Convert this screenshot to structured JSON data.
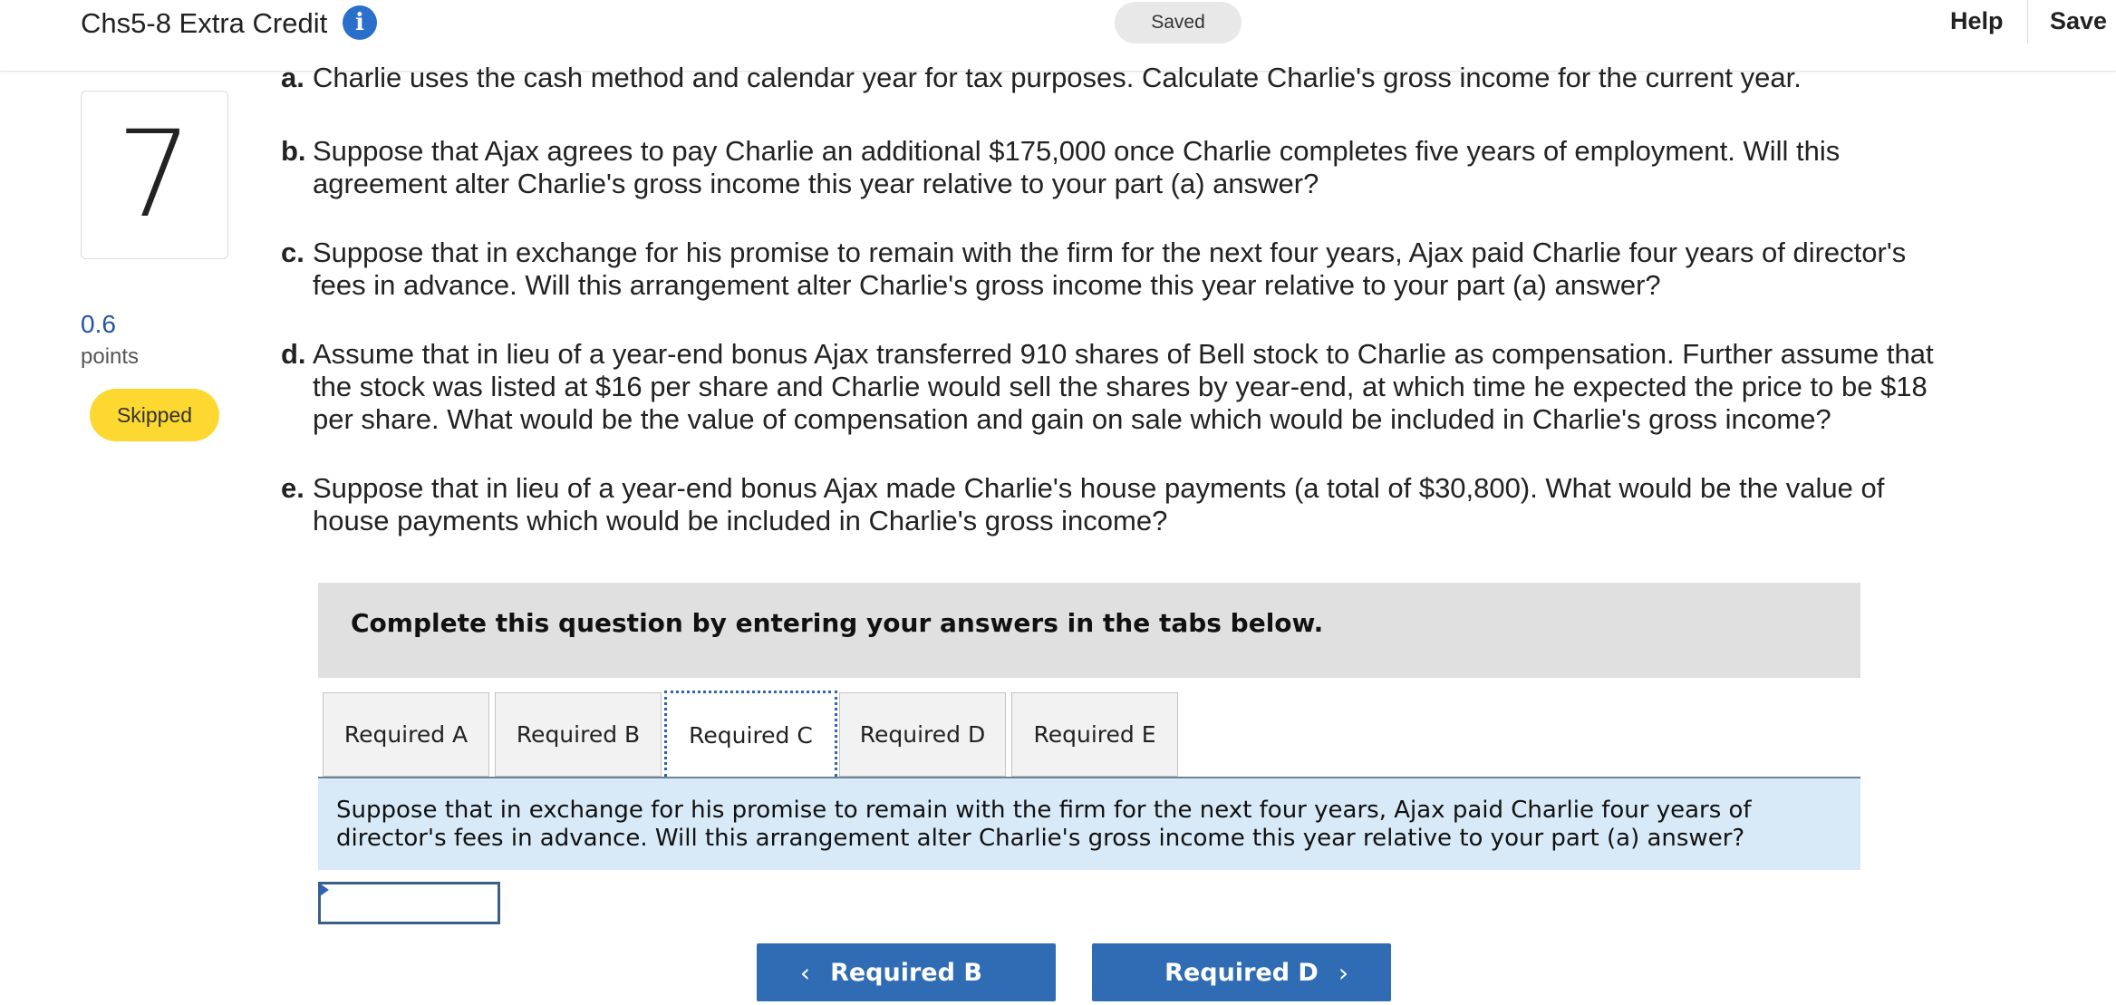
{
  "header": {
    "title": "Chs5-8 Extra Credit",
    "info_icon": "i",
    "saved_label": "Saved",
    "help_label": "Help",
    "save_exit_label": "Save"
  },
  "sidebar": {
    "question_number": "7",
    "points_value": "0.6",
    "points_label": "points",
    "status_badge": "Skipped"
  },
  "questions": [
    {
      "letter": "a.",
      "text": "Charlie uses the cash method and calendar year for tax purposes. Calculate Charlie's gross income for the current year."
    },
    {
      "letter": "b.",
      "text": "Suppose that Ajax agrees to pay Charlie an additional $175,000 once Charlie completes five years of employment. Will this agreement alter Charlie's gross income this year relative to your part (a) answer?"
    },
    {
      "letter": "c.",
      "text": "Suppose that in exchange for his promise to remain with the firm for the next four years, Ajax paid Charlie four years of director's fees in advance. Will this arrangement alter Charlie's gross income this year relative to your part (a) answer?"
    },
    {
      "letter": "d.",
      "text": "Assume that in lieu of a year-end bonus Ajax transferred 910 shares of Bell stock to Charlie as compensation. Further assume that the stock was listed at $16 per share and Charlie would sell the shares by year-end, at which time he expected the price to be $18 per share. What would be the value of compensation and gain on sale which would be included in Charlie's gross income?"
    },
    {
      "letter": "e.",
      "text": "Suppose that in lieu of a year-end bonus Ajax made Charlie's house payments (a total of $30,800). What would be the value of house payments which would be included in Charlie's gross income?"
    }
  ],
  "instruction": "Complete this question by entering your answers in the tabs below.",
  "tabs": [
    {
      "label": "Required A"
    },
    {
      "label": "Required B"
    },
    {
      "label": "Required C"
    },
    {
      "label": "Required D"
    },
    {
      "label": "Required E"
    }
  ],
  "active_tab": "Required C",
  "prompt": "Suppose that in exchange for his promise to remain with the firm for the next four years, Ajax paid Charlie four years of director's fees in advance. Will this arrangement alter Charlie's gross income this year relative to your part (a) answer?",
  "answer_value": "",
  "nav": {
    "prev_label": "Required B",
    "next_label": "Required D",
    "prev_icon": "chevron-left-icon",
    "next_icon": "chevron-right-icon"
  },
  "colors": {
    "accent": "#2f6cb4",
    "badge": "#fcd831",
    "prompt_bg": "#d8eaf8",
    "points": "#2354a0"
  }
}
